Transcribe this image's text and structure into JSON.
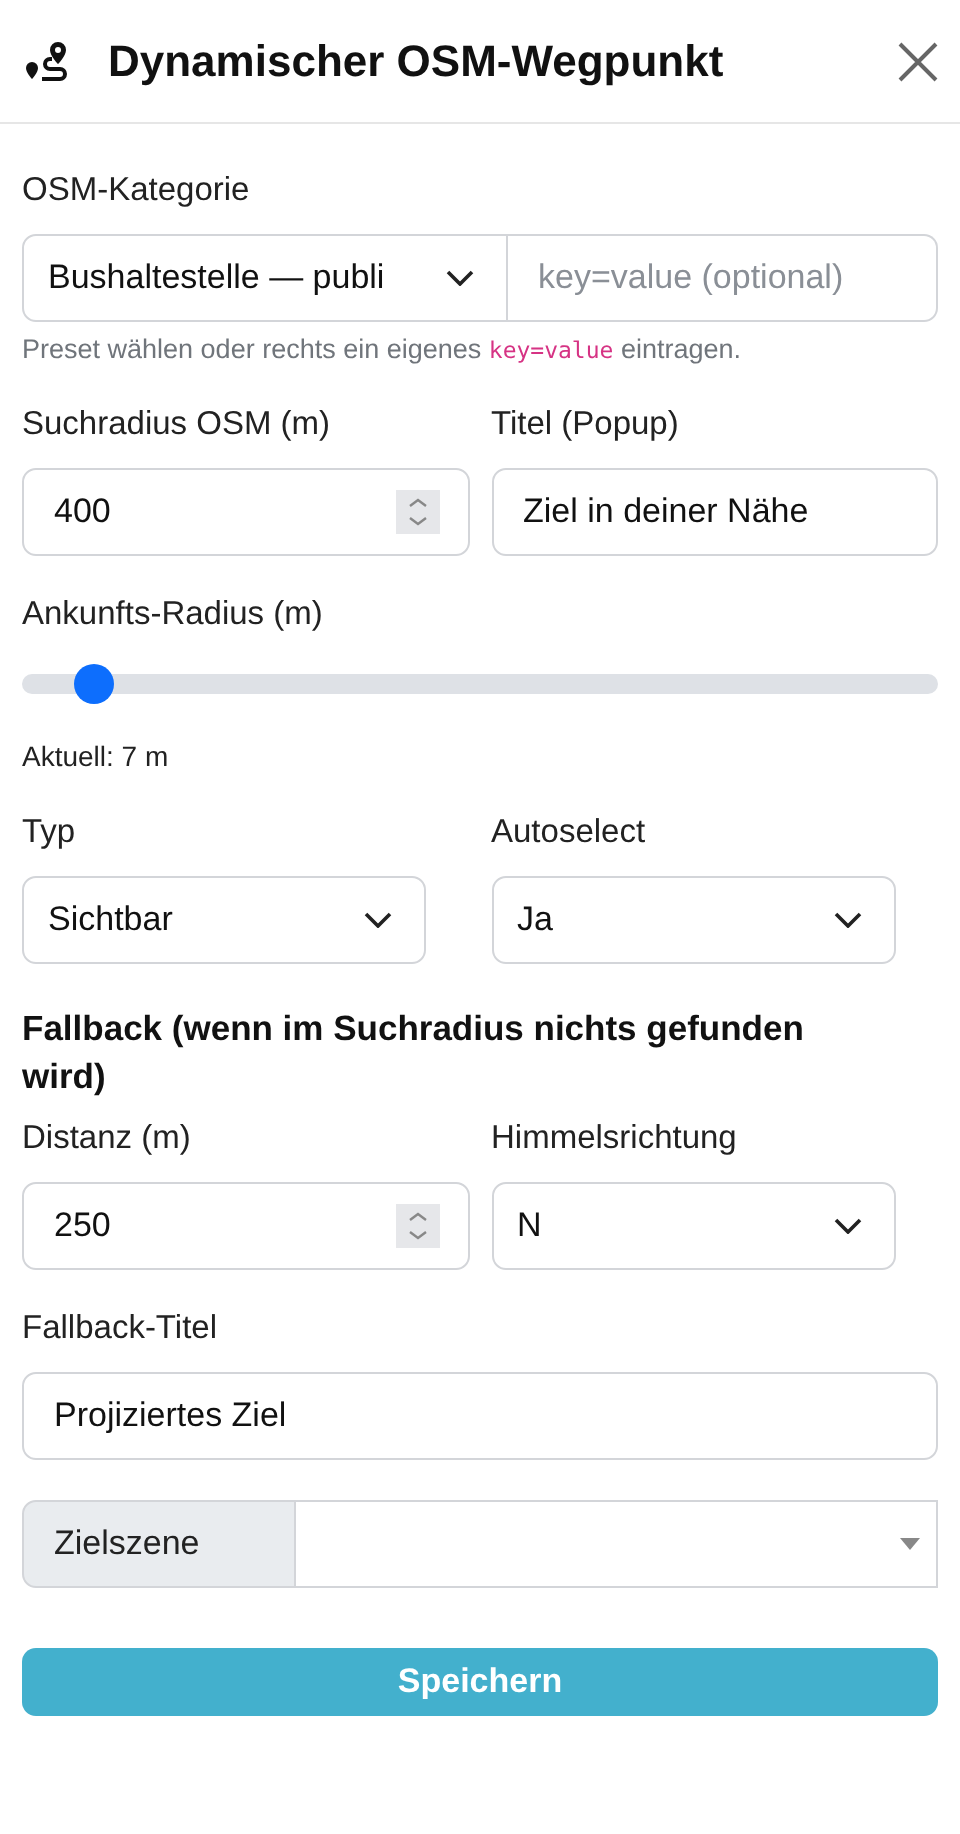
{
  "header": {
    "title": "Dynamischer OSM-Wegpunkt"
  },
  "category": {
    "label": "OSM-Kategorie",
    "preset": "Bushaltestelle — publi",
    "custom_placeholder": "key=value (optional)",
    "hint_before": "Preset wählen oder rechts ein eigenes",
    "hint_code": "key=value",
    "hint_after": "eintragen."
  },
  "search_radius": {
    "label": "Suchradius OSM (m)",
    "value": "400"
  },
  "popup_title": {
    "label": "Titel (Popup)",
    "value": "Ziel in deiner Nähe"
  },
  "arrival_radius": {
    "label": "Ankunfts-Radius (m)",
    "level": 0.04,
    "reading": "Aktuell: 7 m"
  },
  "type": {
    "label": "Typ",
    "value": "Sichtbar"
  },
  "autoselect": {
    "label": "Autoselect",
    "value": "Ja"
  },
  "fallback": {
    "heading": "Fallback (wenn im Suchradius nichts gefunden wird)",
    "distance": {
      "label": "Distanz (m)",
      "value": "250"
    },
    "direction": {
      "label": "Himmelsrichtung",
      "value": "N"
    },
    "title": {
      "label": "Fallback-Titel",
      "value": "Projiziertes Ziel"
    }
  },
  "target_scene": {
    "label": "Zielszene"
  },
  "save_button": "Speichern"
}
